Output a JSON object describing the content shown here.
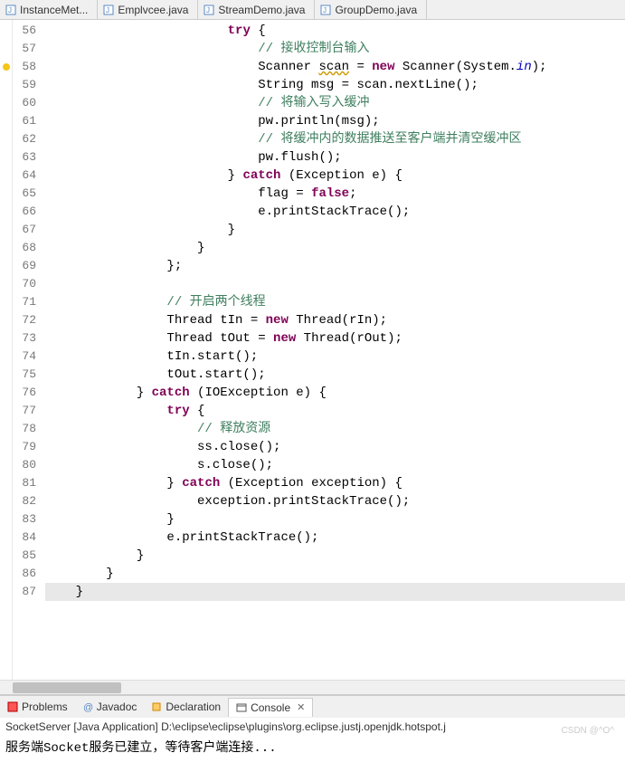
{
  "tabs": [
    {
      "label": "InstanceMet..."
    },
    {
      "label": "Emplvcee.java"
    },
    {
      "label": "StreamDemo.java"
    },
    {
      "label": "GroupDemo.java"
    }
  ],
  "lines": {
    "start": 56,
    "end": 87
  },
  "code": {
    "l56": {
      "indent": "                        ",
      "kw": "try",
      "rest": " {"
    },
    "l57": {
      "indent": "                            ",
      "comment": "// 接收控制台输入"
    },
    "l58": {
      "indent": "                            ",
      "t1": "Scanner ",
      "u": "scan",
      "t2": " = ",
      "kw": "new",
      "t3": " Scanner(System.",
      "fld": "in",
      "t4": ");"
    },
    "l59": {
      "indent": "                            ",
      "text": "String msg = scan.nextLine();"
    },
    "l60": {
      "indent": "                            ",
      "comment": "// 将输入写入缓冲"
    },
    "l61": {
      "indent": "                            ",
      "text": "pw.println(msg);"
    },
    "l62": {
      "indent": "                            ",
      "comment": "// 将缓冲内的数据推送至客户端并清空缓冲区"
    },
    "l63": {
      "indent": "                            ",
      "text": "pw.flush();"
    },
    "l64": {
      "indent": "                        ",
      "t1": "} ",
      "kw": "catch",
      "t2": " (Exception e) {"
    },
    "l65": {
      "indent": "                            ",
      "t1": "flag = ",
      "kw": "false",
      "t2": ";"
    },
    "l66": {
      "indent": "                            ",
      "text": "e.printStackTrace();"
    },
    "l67": {
      "indent": "                        ",
      "text": "}"
    },
    "l68": {
      "indent": "                    ",
      "text": "}"
    },
    "l69": {
      "indent": "                ",
      "text": "};"
    },
    "l70": {
      "indent": "",
      "text": ""
    },
    "l71": {
      "indent": "                ",
      "comment": "// 开启两个线程"
    },
    "l72": {
      "indent": "                ",
      "t1": "Thread tIn = ",
      "kw": "new",
      "t2": " Thread(rIn);"
    },
    "l73": {
      "indent": "                ",
      "t1": "Thread tOut = ",
      "kw": "new",
      "t2": " Thread(rOut);"
    },
    "l74": {
      "indent": "                ",
      "text": "tIn.start();"
    },
    "l75": {
      "indent": "                ",
      "text": "tOut.start();"
    },
    "l76": {
      "indent": "            ",
      "t1": "} ",
      "kw": "catch",
      "t2": " (IOException e) {"
    },
    "l77": {
      "indent": "                ",
      "kw": "try",
      "rest": " {"
    },
    "l78": {
      "indent": "                    ",
      "comment": "// 释放资源"
    },
    "l79": {
      "indent": "                    ",
      "text": "ss.close();"
    },
    "l80": {
      "indent": "                    ",
      "text": "s.close();"
    },
    "l81": {
      "indent": "                ",
      "t1": "} ",
      "kw": "catch",
      "t2": " (Exception exception) {"
    },
    "l82": {
      "indent": "                    ",
      "text": "exception.printStackTrace();"
    },
    "l83": {
      "indent": "                ",
      "text": "}"
    },
    "l84": {
      "indent": "                ",
      "text": "e.printStackTrace();"
    },
    "l85": {
      "indent": "            ",
      "text": "}"
    },
    "l86": {
      "indent": "        ",
      "text": "}"
    },
    "l87": {
      "indent": "    ",
      "text": "}"
    }
  },
  "bottomTabs": {
    "problems": "Problems",
    "javadoc": "Javadoc",
    "declaration": "Declaration",
    "console": "Console"
  },
  "console": {
    "header": "SocketServer [Java Application] D:\\eclipse\\eclipse\\plugins\\org.eclipse.justj.openjdk.hotspot.j",
    "line1": "服务端Socket服务已建立，等待客户端连接..."
  },
  "watermark": "CSDN @^O^"
}
